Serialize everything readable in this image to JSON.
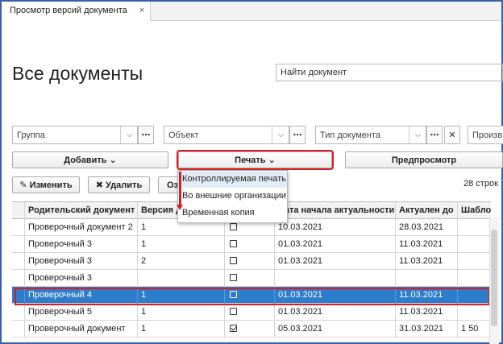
{
  "tab": {
    "title": "Просмотр версий документа",
    "close": "×"
  },
  "page": {
    "title": "Все документы"
  },
  "search": {
    "placeholder": "Найти документ"
  },
  "filters": [
    {
      "placeholder": "Группа"
    },
    {
      "placeholder": "Объект"
    },
    {
      "placeholder": "Тип документа"
    },
    {
      "placeholder": "Произв"
    }
  ],
  "toolbar": {
    "add_label": "Добавить ⌄",
    "print_label": "Печать ⌄",
    "preview_label": "Предпросмотр",
    "edit_label": "✎ Изменить",
    "delete_label": "✖ Удалить",
    "partial_label": "Оз",
    "row_count": "28 строк"
  },
  "print_menu": {
    "items": [
      "Контроллируемая печать",
      "Во внешние организации",
      "Временная копия"
    ]
  },
  "table": {
    "columns": [
      "Родительский документ",
      "Версия д",
      "",
      "Дата начала актуальности",
      "Актуален до",
      "Шабло"
    ],
    "rows": [
      [
        "Проверочный документ 2",
        "1",
        "",
        "10.03.2021",
        "28.03.2021",
        ""
      ],
      [
        "Проверочный 3",
        "1",
        "",
        "01.03.2021",
        "11.03.2021",
        ""
      ],
      [
        "Проверочный 3",
        "2",
        "",
        "01.03.2021",
        "11.03.2021",
        ""
      ],
      [
        "Проверочный 3",
        "",
        "",
        "",
        "",
        ""
      ],
      [
        "Проверочный 4",
        "1",
        "",
        "01.03.2021",
        "11.03.2021",
        ""
      ],
      [
        "Проверочный 5",
        "1",
        "",
        "01.03.2021",
        "11.03.2021",
        ""
      ],
      [
        "Проверочный документ",
        "1",
        "",
        "05.03.2021",
        "31.03.2021",
        "1 50"
      ]
    ],
    "checked": [
      false,
      false,
      false,
      false,
      false,
      false,
      true
    ],
    "selected_row": 4
  },
  "colors": {
    "accent": "#2e7ccc",
    "highlight_frame": "#d41f25",
    "window_border": "#3b5ea8"
  }
}
